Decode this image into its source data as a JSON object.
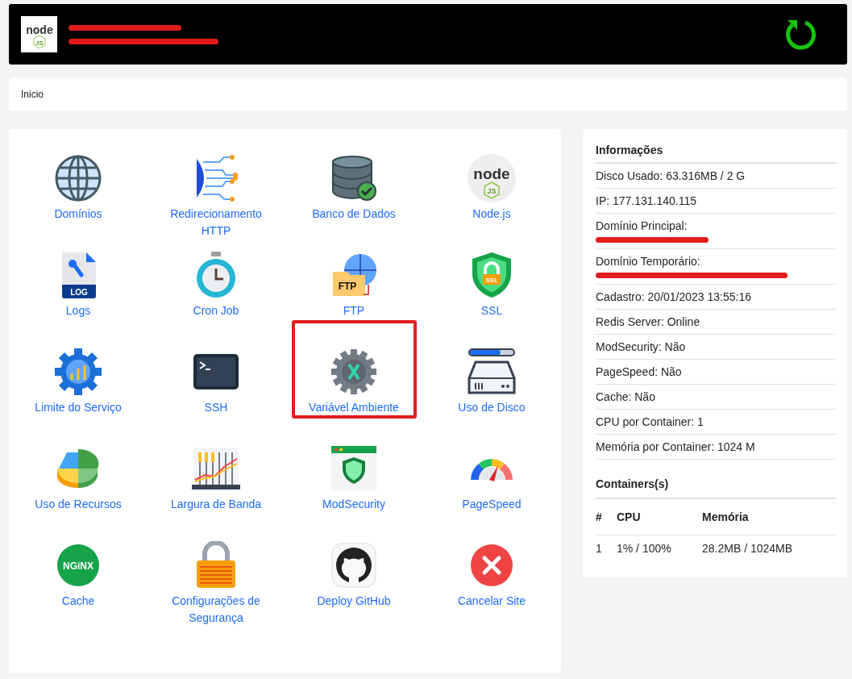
{
  "header": {
    "logo": {
      "text": "node",
      "badge": "JS"
    }
  },
  "breadcrumb": "Inicio",
  "tiles": [
    {
      "label": "Domínios",
      "kind": "globe",
      "highlighted": false
    },
    {
      "label": "Redirecionamento HTTP",
      "kind": "network",
      "highlighted": false
    },
    {
      "label": "Banco de Dados",
      "kind": "database",
      "highlighted": false
    },
    {
      "label": "Node.js",
      "kind": "nodejs",
      "icon_text": "node",
      "icon_badge": "JS",
      "highlighted": false
    },
    {
      "label": "Logs",
      "kind": "log",
      "icon_text": "LOG",
      "highlighted": false
    },
    {
      "label": "Cron Job",
      "kind": "stopwatch",
      "highlighted": false
    },
    {
      "label": "FTP",
      "kind": "ftp",
      "icon_text": "FTP",
      "highlighted": false
    },
    {
      "label": "SSL",
      "kind": "ssl",
      "icon_text": "SSL",
      "highlighted": false
    },
    {
      "label": "Limite do Serviço",
      "kind": "gear-chart",
      "highlighted": false
    },
    {
      "label": "SSH",
      "kind": "terminal",
      "highlighted": false
    },
    {
      "label": "Variável Ambiente",
      "kind": "gear-x",
      "highlighted": true
    },
    {
      "label": "Uso de Disco",
      "kind": "disk",
      "highlighted": false
    },
    {
      "label": "Uso de Recursos",
      "kind": "pie",
      "highlighted": false
    },
    {
      "label": "Largura de Banda",
      "kind": "bandwidth",
      "highlighted": false
    },
    {
      "label": "ModSecurity",
      "kind": "shield-window",
      "highlighted": false
    },
    {
      "label": "PageSpeed",
      "kind": "gauge",
      "highlighted": false
    },
    {
      "label": "Cache",
      "kind": "nginx",
      "icon_text": "NGiNX",
      "highlighted": false
    },
    {
      "label": "Configurações de Segurança",
      "kind": "lock",
      "highlighted": false
    },
    {
      "label": "Deploy GitHub",
      "kind": "github",
      "highlighted": false
    },
    {
      "label": "Cancelar Site",
      "kind": "cancel",
      "highlighted": false
    }
  ],
  "info": {
    "title": "Informações",
    "rows": [
      {
        "text": "Disco Usado: 63.316MB / 2 G"
      },
      {
        "text": "IP: 177.131.140.115"
      },
      {
        "text": "Domínio Principal:",
        "redacted_link": true
      },
      {
        "text": "Domínio Temporário:",
        "redacted_link": true
      },
      {
        "text": "Cadastro: 20/01/2023 13:55:16"
      },
      {
        "text": "Redis Server: Online"
      },
      {
        "text": "ModSecurity: Não"
      },
      {
        "text": "PageSpeed: Não"
      },
      {
        "text": "Cache: Não"
      },
      {
        "text": "CPU por Container: 1"
      },
      {
        "text": "Memória por Container: 1024 M"
      }
    ]
  },
  "containers": {
    "title": "Containers(s)",
    "columns": [
      "#",
      "CPU",
      "Memória"
    ],
    "rows": [
      [
        "1",
        "1% / 100%",
        "28.2MB / 1024MB"
      ]
    ]
  }
}
